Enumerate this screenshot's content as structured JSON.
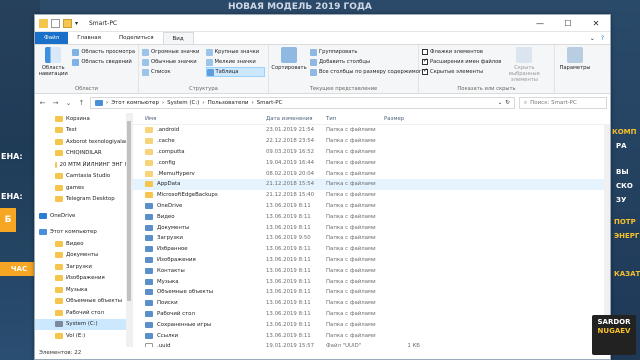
{
  "background": {
    "banner_top": "НОВАЯ МОДЕЛЬ 2019 ГОДА",
    "left_lines": [
      "ЕНА:",
      "ЕНА:",
      "Б",
      "ЧАС"
    ],
    "right_lines": [
      "КОМП",
      "РА",
      "ВЫ",
      "СКО",
      "ЗУ",
      "ПОТР",
      "ЭНЕРГ",
      "КАЗАТ"
    ],
    "logo_lines": [
      "SARDOR",
      "NUGAEV"
    ]
  },
  "window": {
    "title": "Smart-PC",
    "minimize": "—",
    "maximize": "☐",
    "close": "✕"
  },
  "tabs": [
    "Файл",
    "Главная",
    "Поделиться",
    "Вид"
  ],
  "ribbon": {
    "panes": {
      "nav_pane": "Область навигации",
      "preview": "Область просмотра",
      "details": "Область сведений",
      "label": "Области"
    },
    "layout": {
      "items": [
        "Огромные значки",
        "Крупные значки",
        "Обычные значки",
        "Мелкие значки",
        "Список",
        "Таблица"
      ],
      "label": "Структура"
    },
    "view": {
      "sort": "Сортировать",
      "group": "Группировать",
      "add_columns": "Добавить столбцы",
      "fit_columns": "Все столбцы по размеру содержимого",
      "label": "Текущее представление"
    },
    "show": {
      "checkboxes": "Флажки элементов",
      "extensions": "Расширения имен файлов",
      "hidden": "Скрытые элементы",
      "hide_selected": "Скрыть выбранные элементы",
      "label": "Показать или скрыть"
    },
    "options": "Параметры"
  },
  "address": {
    "crumbs": [
      "Этот компьютер",
      "System (C:)",
      "Пользователи",
      "Smart-PC"
    ],
    "search_placeholder": "Поиск: Smart-PC"
  },
  "nav": [
    {
      "label": "Корзина",
      "type": "sub"
    },
    {
      "label": "Test",
      "type": "sub"
    },
    {
      "label": "Axborot texnologiyalari",
      "type": "sub"
    },
    {
      "label": "CHIQINDILAR",
      "type": "sub"
    },
    {
      "label": "20 МТМ ЙИЛНИНГ ЭНГ ЯХ",
      "type": "sub"
    },
    {
      "label": "Camtasia Studio",
      "type": "sub"
    },
    {
      "label": "games",
      "type": "sub"
    },
    {
      "label": "Telegram Desktop",
      "type": "sub"
    },
    {
      "label": "",
      "type": "gap"
    },
    {
      "label": "OneDrive",
      "type": "top"
    },
    {
      "label": "",
      "type": "gap"
    },
    {
      "label": "Этот компьютер",
      "type": "top"
    },
    {
      "label": "Видео",
      "type": "sub"
    },
    {
      "label": "Документы",
      "type": "sub"
    },
    {
      "label": "Загрузки",
      "type": "sub"
    },
    {
      "label": "Изображения",
      "type": "sub"
    },
    {
      "label": "Музыка",
      "type": "sub"
    },
    {
      "label": "Объемные объекты",
      "type": "sub"
    },
    {
      "label": "Рабочий стол",
      "type": "sub"
    },
    {
      "label": "System (C:)",
      "type": "sel"
    },
    {
      "label": "Vol (E:)",
      "type": "sub"
    }
  ],
  "columns": [
    "Имя",
    "Дата изменения",
    "Тип",
    "Размер"
  ],
  "files": [
    {
      "name": ".android",
      "date": "23.01.2019 21:54",
      "type": "Папка с файлами",
      "size": ""
    },
    {
      "name": ".cache",
      "date": "22.12.2018 23:54",
      "type": "Папка с файлами",
      "size": ""
    },
    {
      "name": ".computta",
      "date": "09.03.2019 16:52",
      "type": "Папка с файлами",
      "size": ""
    },
    {
      "name": ".config",
      "date": "19.04.2019 16:44",
      "type": "Папка с файлами",
      "size": ""
    },
    {
      "name": ".MemuHyperv",
      "date": "08.02.2019 20:04",
      "type": "Папка с файлами",
      "size": ""
    },
    {
      "name": "AppData",
      "date": "21.12.2018 15:54",
      "type": "Папка с файлами",
      "size": ""
    },
    {
      "name": "MicrosoftEdgeBackups",
      "date": "21.12.2018 15:40",
      "type": "Папка с файлами",
      "size": ""
    },
    {
      "name": "OneDrive",
      "date": "13.06.2019 8:11",
      "type": "Папка с файлами",
      "size": ""
    },
    {
      "name": "Видео",
      "date": "13.06.2019 8:11",
      "type": "Папка с файлами",
      "size": ""
    },
    {
      "name": "Документы",
      "date": "13.06.2019 8:11",
      "type": "Папка с файлами",
      "size": ""
    },
    {
      "name": "Загрузки",
      "date": "13.06.2019 9:50",
      "type": "Папка с файлами",
      "size": ""
    },
    {
      "name": "Избранное",
      "date": "13.06.2019 8:11",
      "type": "Папка с файлами",
      "size": ""
    },
    {
      "name": "Изображения",
      "date": "13.06.2019 8:11",
      "type": "Папка с файлами",
      "size": ""
    },
    {
      "name": "Контакты",
      "date": "13.06.2019 8:11",
      "type": "Папка с файлами",
      "size": ""
    },
    {
      "name": "Музыка",
      "date": "13.06.2019 8:11",
      "type": "Папка с файлами",
      "size": ""
    },
    {
      "name": "Объемные объекты",
      "date": "13.06.2019 8:11",
      "type": "Папка с файлами",
      "size": ""
    },
    {
      "name": "Поиски",
      "date": "13.06.2019 8:11",
      "type": "Папка с файлами",
      "size": ""
    },
    {
      "name": "Рабочий стол",
      "date": "13.06.2019 8:11",
      "type": "Папка с файлами",
      "size": ""
    },
    {
      "name": "Сохраненные игры",
      "date": "13.06.2019 8:11",
      "type": "Папка с файлами",
      "size": ""
    },
    {
      "name": "Ссылки",
      "date": "13.06.2019 8:11",
      "type": "Папка с файлами",
      "size": ""
    },
    {
      "name": ".uuid",
      "date": "19.01.2019 15:57",
      "type": "Файл \"UUID\"",
      "size": "1 КБ"
    }
  ],
  "status": "Элементов: 22",
  "colors": {
    "accent": "#1a6fc9",
    "folder": "#f4c64d",
    "selected": "#cce8ff"
  }
}
